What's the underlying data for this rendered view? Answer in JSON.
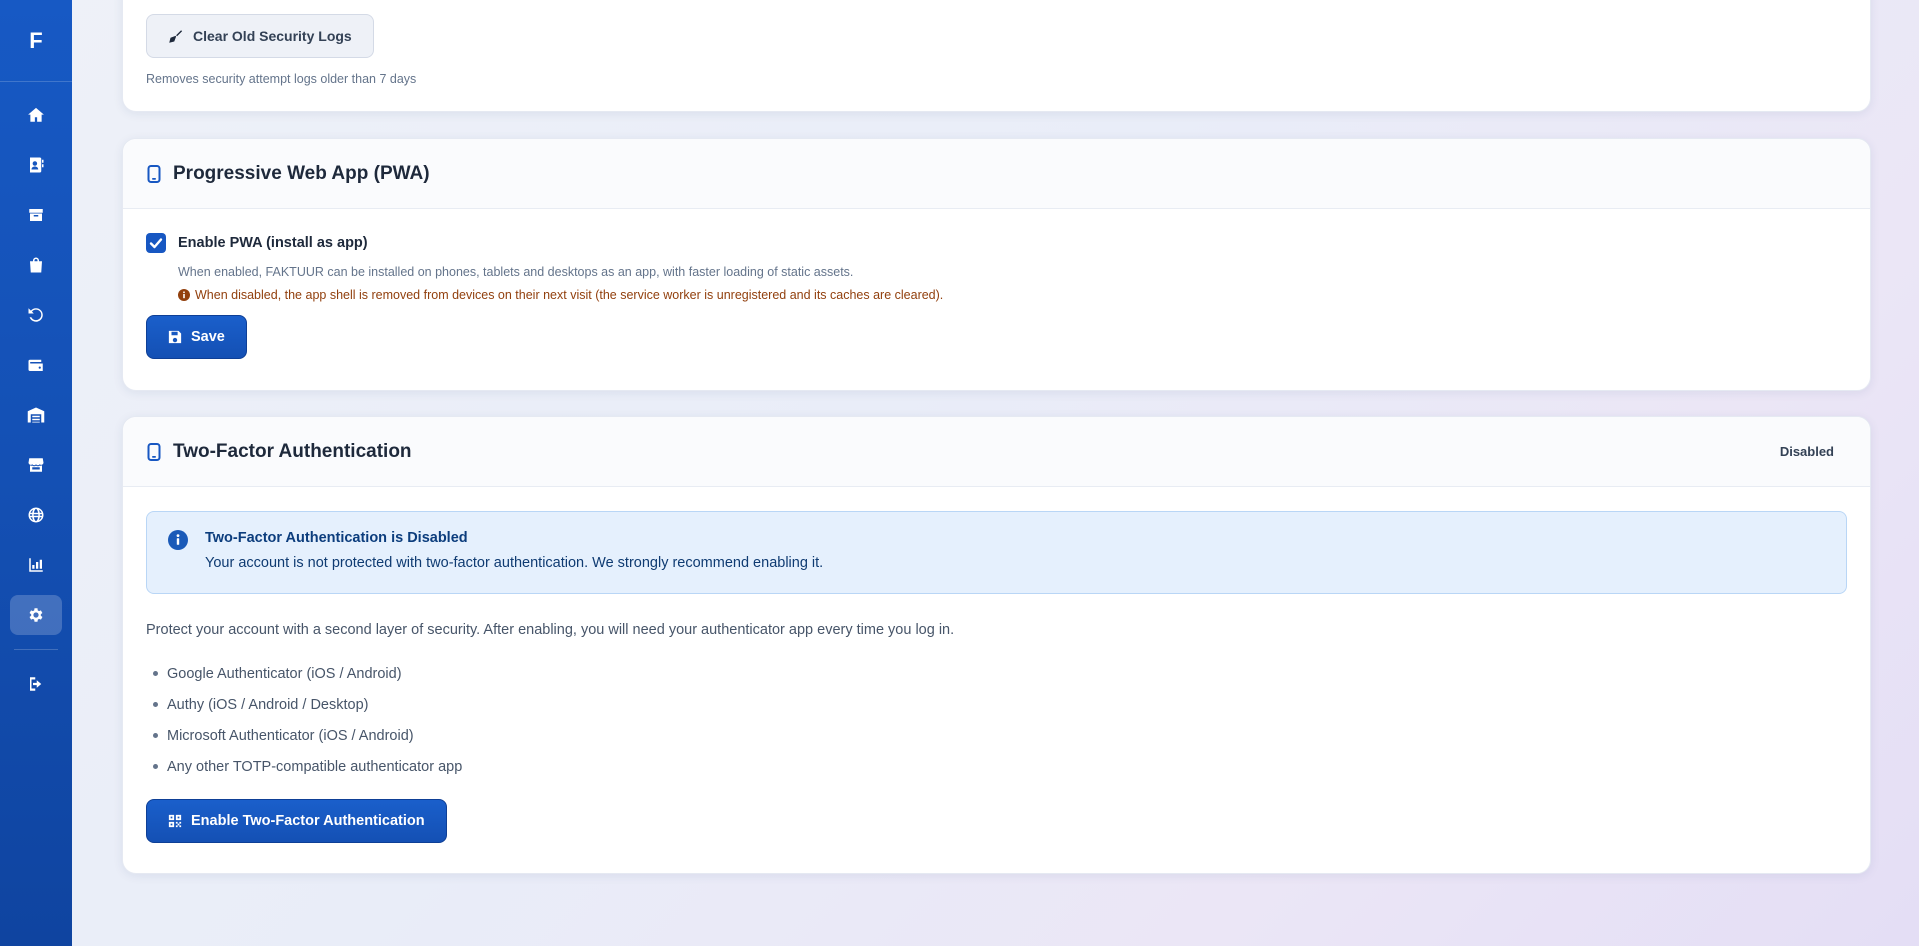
{
  "sidebar": {
    "logo": "F",
    "items": [
      {
        "icon": "home-icon",
        "active": false
      },
      {
        "icon": "contacts-icon",
        "active": false
      },
      {
        "icon": "box-icon",
        "active": false
      },
      {
        "icon": "shopping-bag-icon",
        "active": false
      },
      {
        "icon": "history-icon",
        "active": false
      },
      {
        "icon": "wallet-icon",
        "active": false
      },
      {
        "icon": "warehouse-icon",
        "active": false
      },
      {
        "icon": "store-icon",
        "active": false
      },
      {
        "icon": "globe-icon",
        "active": false
      },
      {
        "icon": "chart-bar-icon",
        "active": false
      },
      {
        "icon": "gear-icon",
        "active": true
      }
    ],
    "logout_icon": "logout-icon"
  },
  "security_logs": {
    "clear_button_label": "Clear Old Security Logs",
    "note": "Removes security attempt logs older than 7 days"
  },
  "pwa": {
    "title": "Progressive Web App (PWA)",
    "checkbox_label": "Enable PWA (install as app)",
    "checked": true,
    "help": "When enabled, FAKTUUR can be installed on phones, tablets and desktops as an app, with faster loading of static assets.",
    "warning": "When disabled, the app shell is removed from devices on their next visit (the service worker is unregistered and its caches are cleared).",
    "save_label": "Save"
  },
  "two_factor": {
    "title": "Two-Factor Authentication",
    "status": "Disabled",
    "alert_title": "Two-Factor Authentication is Disabled",
    "alert_text": "Your account is not protected with two-factor authentication. We strongly recommend enabling it.",
    "description": "Protect your account with a second layer of security. After enabling, you will need your authenticator app every time you log in.",
    "apps": [
      "Google Authenticator (iOS / Android)",
      "Authy (iOS / Android / Desktop)",
      "Microsoft Authenticator (iOS / Android)",
      "Any other TOTP-compatible authenticator app"
    ],
    "enable_label": "Enable Two-Factor Authentication"
  },
  "colors": {
    "brand": "#1757c2",
    "warning": "#92400e",
    "info_bg": "#e5f0fd"
  }
}
